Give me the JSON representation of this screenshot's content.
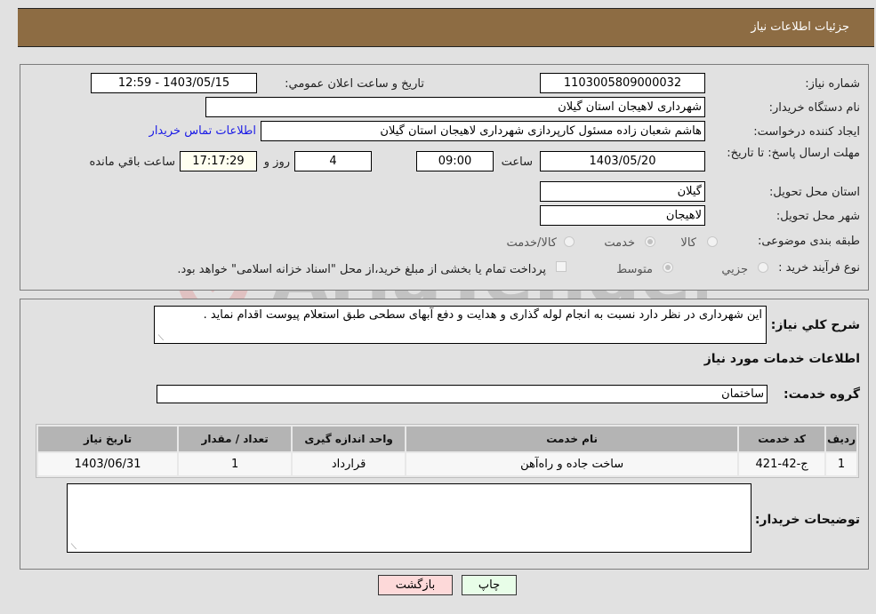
{
  "header": {
    "title": "جزئیات اطلاعات نیاز"
  },
  "details": {
    "need_number_label": "شماره نیاز:",
    "need_number": "1103005809000032",
    "announce_label": "تاریخ و ساعت اعلان عمومي:",
    "announce_value": "1403/05/15 - 12:59",
    "buyer_org_label": "نام دستگاه خريدار:",
    "buyer_org": "شهرداری لاهیجان استان گیلان",
    "creator_label": "ايجاد کننده درخواست:",
    "creator": "هاشم شعبان زاده مسئول کارپردازی شهرداری لاهیجان استان گیلان",
    "contact_link": "اطلاعات تماس خريدار",
    "deadline_label": "مهلت ارسال پاسخ: تا تاریخ:",
    "deadline_date": "1403/05/20",
    "time_label": "ساعت",
    "deadline_time": "09:00",
    "days_value": "4",
    "days_label": "روز و",
    "remaining_time": "17:17:29",
    "remaining_label": "ساعت باقي مانده",
    "province_label": "استان محل تحویل:",
    "province": "گیلان",
    "city_label": "شهر محل تحویل:",
    "city": "لاهیجان",
    "category_label": "طبقه بندی موضوعی:",
    "category_options": [
      {
        "label": "کالا",
        "checked": false
      },
      {
        "label": "خدمت",
        "checked": true
      },
      {
        "label": "کالا/خدمت",
        "checked": false
      }
    ],
    "process_label": "نوع فرآیند خرید :",
    "process_options": [
      {
        "label": "جزيي",
        "checked": false
      },
      {
        "label": "متوسط",
        "checked": true
      }
    ],
    "treasury_note": "پرداخت تمام يا بخشی از مبلغ خريد،از محل \"اسناد خزانه اسلامی\" خواهد بود.",
    "treasury_checked": false
  },
  "summary": {
    "label": "شرح کلي نياز:",
    "text": "این شهرداری  در نظر دارد نسبت به انجام لوله گذاری و هدایت و دفع آبهای سطحی طبق استعلام پیوست اقدام نماید ."
  },
  "services": {
    "section_title": "اطلاعات خدمات مورد نياز",
    "group_label": "گروه خدمت:",
    "group_value": "ساختمان",
    "columns": [
      "رديف",
      "کد خدمت",
      "نام خدمت",
      "واحد اندازه گيری",
      "تعداد / مقدار",
      "تاريخ نياز"
    ],
    "rows": [
      [
        "1",
        "ج-42-421",
        "ساخت جاده و راه‌آهن",
        "قرارداد",
        "1",
        "1403/06/31"
      ]
    ]
  },
  "buyer_notes": {
    "label": "توضيحات خريدار:",
    "text": ""
  },
  "buttons": {
    "print": "چاپ",
    "back": "بازگشت"
  },
  "watermark": {
    "text": "AriaTender.neT"
  },
  "colors": {
    "header_bg": "#8d6c43",
    "print_bg": "#e8fde8",
    "back_bg": "#fdd9d9"
  }
}
